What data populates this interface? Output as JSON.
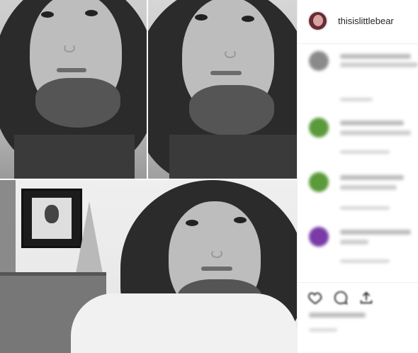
{
  "post": {
    "username": "thisislittlebear"
  },
  "colors": {
    "avatar_ring": "#6a2c33",
    "comment_avatar_1": "#8a8a8a",
    "comment_avatar_2": "#5a9a3a",
    "comment_avatar_3": "#5a9a3a",
    "comment_avatar_4": "#7a3aa8"
  },
  "icons": {
    "like": "heart-icon",
    "comment": "comment-icon",
    "share": "share-icon"
  }
}
